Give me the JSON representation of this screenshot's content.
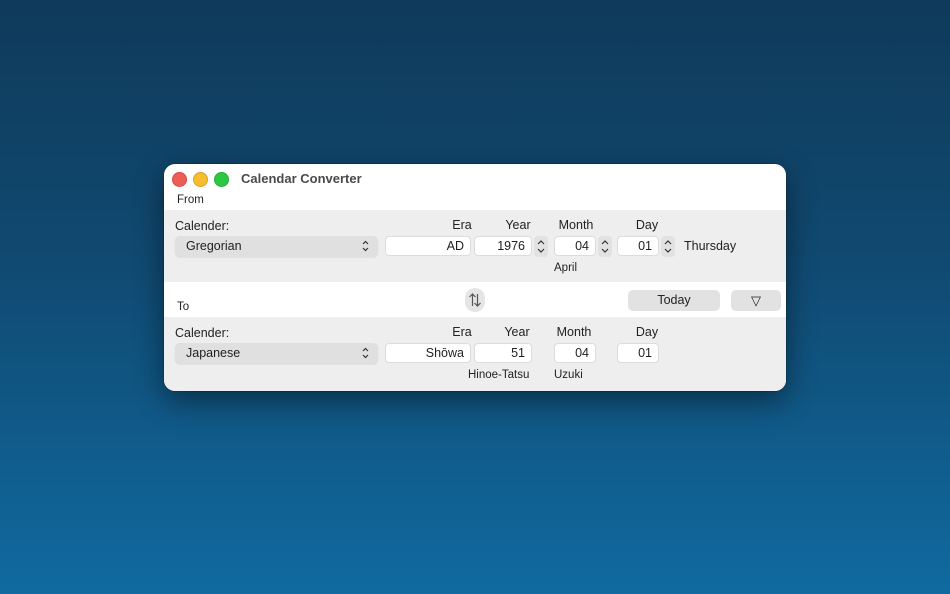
{
  "window": {
    "title": "Calendar Converter"
  },
  "from": {
    "section_label": "From",
    "calendar_label": "Calender:",
    "calendar_value": "Gregorian",
    "headers": {
      "era": "Era",
      "year": "Year",
      "month": "Month",
      "day": "Day"
    },
    "era": "AD",
    "year": "1976",
    "month": "04",
    "day": "01",
    "weekday": "Thursday",
    "month_name": "April"
  },
  "controls": {
    "today_label": "Today",
    "menu_label": "▽"
  },
  "to": {
    "section_label": "To",
    "calendar_label": "Calender:",
    "calendar_value": "Japanese",
    "headers": {
      "era": "Era",
      "year": "Year",
      "month": "Month",
      "day": "Day"
    },
    "era": "Shōwa",
    "year": "51",
    "month": "04",
    "day": "01",
    "year_name": "Hinoe-Tatsu",
    "month_name": "Uzuki"
  }
}
